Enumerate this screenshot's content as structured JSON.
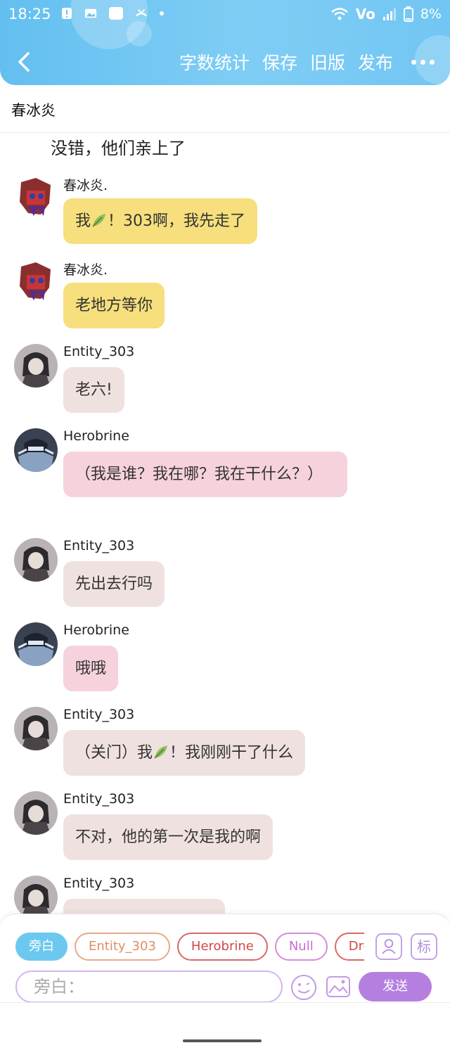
{
  "status": {
    "time": "18:25",
    "battery": "8%",
    "net": "Vo"
  },
  "header": {
    "actions": [
      "字数统计",
      "保存",
      "旧版",
      "发布"
    ]
  },
  "title": "春冰炎",
  "narration": "没错，他们亲上了",
  "messages": [
    {
      "sender": "春冰炎.",
      "before": "我",
      "after": "！303啊，我先走了",
      "style": "yellow"
    },
    {
      "sender": "春冰炎.",
      "text": "老地方等你",
      "style": "yellow"
    },
    {
      "sender": "Entity_303",
      "text": "老六!",
      "style": "gray"
    },
    {
      "sender": "Herobrine",
      "text": "（我是谁？我在哪？我在干什么？）",
      "style": "pink"
    },
    {
      "sender": "Entity_303",
      "text": "先出去行吗",
      "style": "gray"
    },
    {
      "sender": "Herobrine",
      "text": "哦哦",
      "style": "pink"
    },
    {
      "sender": "Entity_303",
      "before": "（关门）我",
      "after": "！我刚刚干了什么",
      "style": "gray"
    },
    {
      "sender": "Entity_303",
      "text": "不对，他的第一次是我的啊",
      "style": "gray"
    },
    {
      "sender": "Entity_303",
      "text": "",
      "style": "gray"
    }
  ],
  "composer": {
    "roles": [
      "旁白",
      "Entity_303",
      "Herobrine",
      "Null",
      "Drea"
    ],
    "placeholder": "旁白：",
    "send_label": "发送",
    "tag_label": "标"
  },
  "colors": {
    "header": "#72c6f3",
    "yellow_bubble": "#f6df7c",
    "gray_bubble": "#f0e1e1",
    "pink_bubble": "#f6d2dc",
    "send": "#b57fe0"
  }
}
